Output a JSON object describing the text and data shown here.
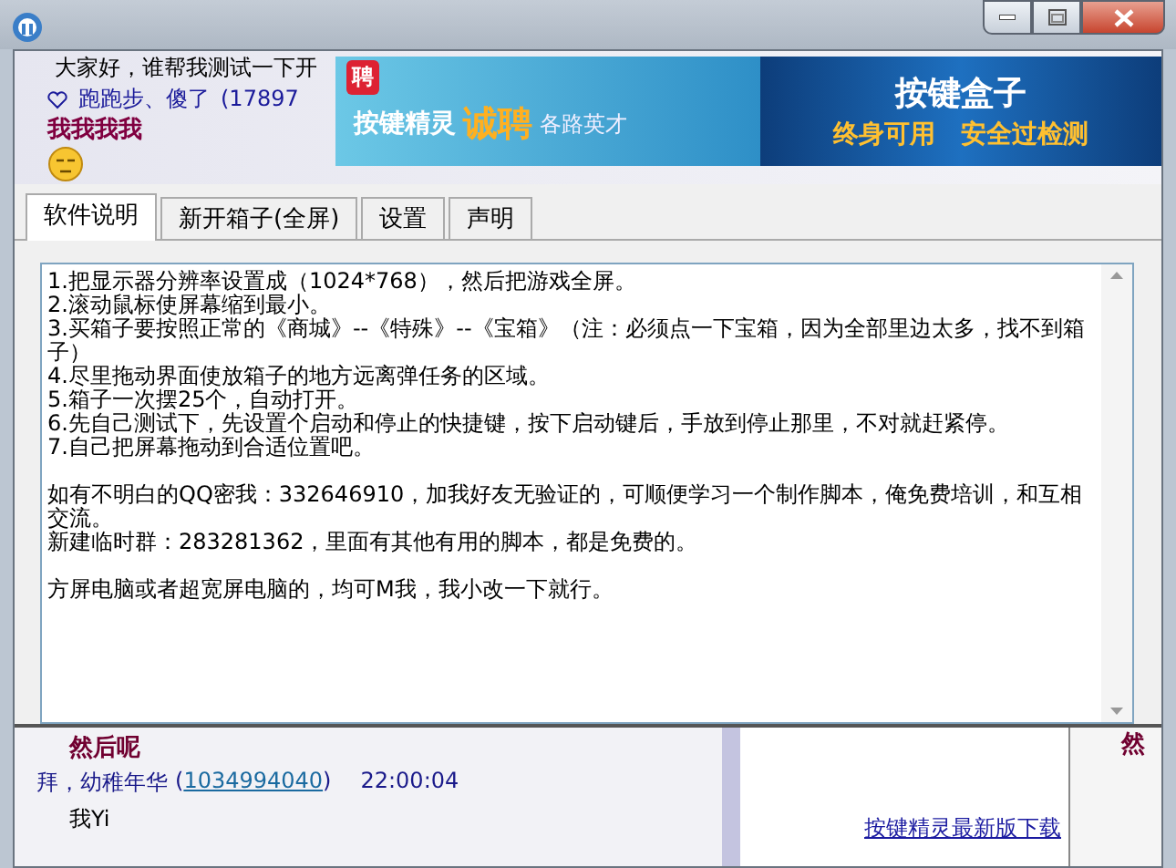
{
  "chat_top": {
    "message": "大家好，谁帮我测试一下开",
    "sender": "跑跑步、傻了",
    "qq_prefix": "(",
    "qq": "17897",
    "shout": "我我我我"
  },
  "banner": {
    "badge": "聘",
    "left_text": "按键精灵",
    "highlight": "诚聘",
    "right_text": "各路英才",
    "title": "按键盒子",
    "slogan": [
      "终身可用",
      "安全过检测"
    ]
  },
  "tabs": [
    {
      "label": "软件说明",
      "selected": true
    },
    {
      "label": "新开箱子(全屏)",
      "selected": false
    },
    {
      "label": "设置",
      "selected": false
    },
    {
      "label": "声明",
      "selected": false
    }
  ],
  "text_box": {
    "paragraphs": [
      [
        "1.把显示器分辨率设置成（1024*768），然后把游戏全屏。",
        "2.滚动鼠标使屏幕缩到最小。",
        "3.买箱子要按照正常的《商城》--《特殊》--《宝箱》（注：必须点一下宝箱，因为全部里边太多，找不到箱子）",
        "4.尽里拖动界面使放箱子的地方远离弹任务的区域。",
        "5.箱子一次摆25个，自动打开。",
        "6.先自己测试下，先设置个启动和停止的快捷键，按下启动键后，手放到停止那里，不对就赶紧停。",
        "7.自己把屏幕拖动到合适位置吧。"
      ],
      [
        "如有不明白的QQ密我：332646910，加我好友无验证的，可顺便学习一个制作脚本，俺免费培训，和互相交流。",
        "新建临时群：283281362，里面有其他有用的脚本，都是免费的。"
      ],
      [
        "方屏电脑或者超宽屏电脑的，均可M我，我小改一下就行。"
      ]
    ]
  },
  "chat_bottom": {
    "shout": "然后呢",
    "sender": "拜，幼稚年华",
    "qq_prefix": "(",
    "qq": "1034994040",
    "qq_suffix": ")",
    "time": "22:00:04",
    "message": "我Yi",
    "link": "按键精灵最新版下载",
    "side_shout": "然"
  }
}
